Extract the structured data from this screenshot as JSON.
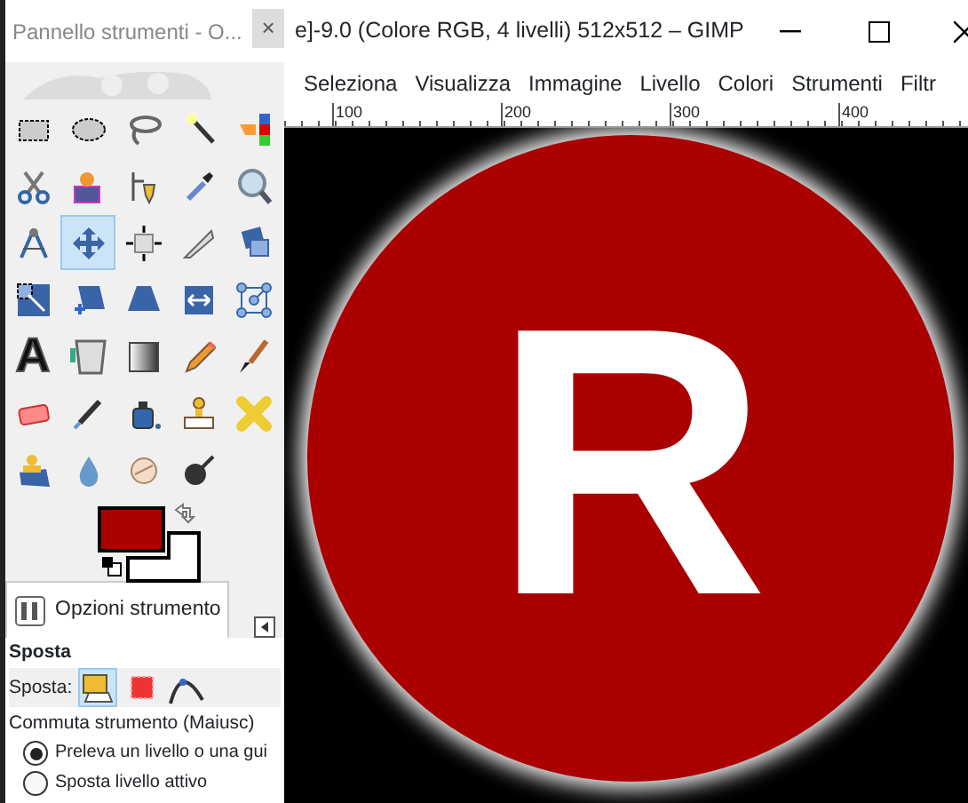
{
  "toolbox": {
    "title": "Pannello strumenti - O...",
    "close": "×",
    "tools": [
      {
        "selected": false
      },
      {
        "selected": false
      },
      {
        "selected": false
      },
      {
        "selected": false
      },
      {
        "selected": false
      },
      {
        "selected": false
      },
      {
        "selected": false
      },
      {
        "selected": false
      },
      {
        "selected": false
      },
      {
        "selected": false
      },
      {
        "selected": false
      },
      {
        "selected": true
      },
      {
        "selected": false
      },
      {
        "selected": false
      },
      {
        "selected": false
      },
      {
        "selected": false
      },
      {
        "selected": false
      },
      {
        "selected": false
      },
      {
        "selected": false
      },
      {
        "selected": false
      },
      {
        "selected": false,
        "glyph": "A"
      },
      {
        "selected": false
      },
      {
        "selected": false
      },
      {
        "selected": false
      },
      {
        "selected": false
      },
      {
        "selected": false
      },
      {
        "selected": false
      },
      {
        "selected": false
      },
      {
        "selected": false
      },
      {
        "selected": false
      },
      {
        "selected": false
      },
      {
        "selected": false
      },
      {
        "selected": false
      },
      {
        "selected": false
      }
    ],
    "tab": {
      "label": "Opzioni strumento",
      "selected": true
    },
    "options": {
      "title": "Sposta",
      "move_label": "Sposta:",
      "modes": [
        {
          "selected": true
        },
        {
          "selected": false
        },
        {
          "selected": false
        }
      ],
      "toggle_label": "Commuta strumento (Maiusc)",
      "radios": [
        {
          "label": "Preleva un livello o una gui",
          "selected": true
        },
        {
          "label": "Sposta livello attivo",
          "selected": false
        }
      ]
    }
  },
  "image_window": {
    "title": "e]-9.0 (Colore RGB, 4 livelli) 512x512 – GIMP",
    "menu": [
      "Seleziona",
      "Visualizza",
      "Immagine",
      "Livello",
      "Colori",
      "Strumenti",
      "Filtr"
    ],
    "ruler": [
      "100",
      "200",
      "300",
      "400"
    ],
    "canvas": {
      "letter": "R"
    }
  }
}
